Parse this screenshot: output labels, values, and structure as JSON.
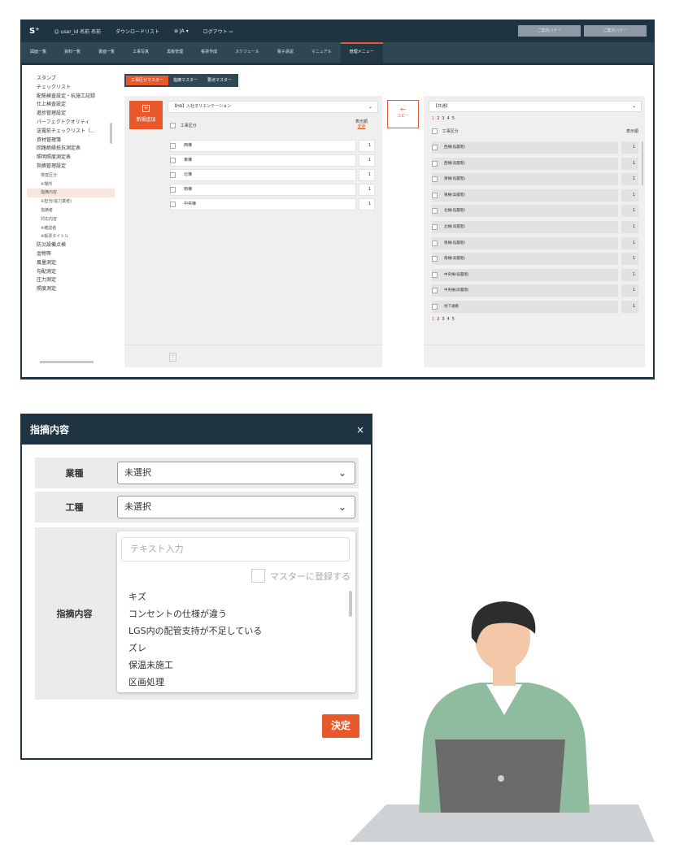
{
  "app": {
    "logo": "S⁺",
    "user": "user_id 名前 名前",
    "download": "ダウンロードリスト",
    "lang": "JA",
    "logout": "ログアウト",
    "btn_right_1": "ご案内バナー",
    "btn_right_2": "ご案内バナー"
  },
  "nav": [
    "図面一覧",
    "資料一覧",
    "書面一覧",
    "工事写真",
    "黒板管理",
    "帳票作成",
    "スケジュール",
    "電子承認",
    "マニュアル",
    "管理メニュー"
  ],
  "sidebar": [
    {
      "label": "スタンプ",
      "sub": false
    },
    {
      "label": "チェックリスト",
      "sub": false
    },
    {
      "label": "配筋検査設定・杭施工記録",
      "sub": false
    },
    {
      "label": "仕上検査設定",
      "sub": false
    },
    {
      "label": "進捗管理設定",
      "sub": false
    },
    {
      "label": "パーフェクトクオリティ",
      "sub": false
    },
    {
      "label": "送電前チェックリスト（…",
      "sub": false
    },
    {
      "label": "資材管理簿",
      "sub": false
    },
    {
      "label": "回路絶縁抵抗測定表",
      "sub": false
    },
    {
      "label": "照明照度測定表",
      "sub": false
    },
    {
      "label": "指摘管理設定",
      "sub": false
    },
    {
      "label": "検査区分",
      "sub": true
    },
    {
      "label": "※場所",
      "sub": true
    },
    {
      "label": "指摘内容",
      "sub": true,
      "selected": true
    },
    {
      "label": "※担当(協力業者)",
      "sub": true
    },
    {
      "label": "指摘者",
      "sub": true
    },
    {
      "label": "対応内容",
      "sub": true
    },
    {
      "label": "※確認者",
      "sub": true
    },
    {
      "label": "※帳票タイトル",
      "sub": true
    },
    {
      "label": "防災設備点検",
      "sub": false
    },
    {
      "label": "金物等",
      "sub": false
    },
    {
      "label": "風量測定",
      "sub": false
    },
    {
      "label": "勾配測定",
      "sub": false
    },
    {
      "label": "圧力測定",
      "sub": false
    },
    {
      "label": "照度測定",
      "sub": false
    }
  ],
  "tabs": [
    "工事区分マスター",
    "指摘マスター",
    "要点マスター"
  ],
  "left_panel": {
    "add_label": "新規追加",
    "select_value": "【HA】入社オリエンテーション",
    "col_name": "工事区分",
    "col_order": "表示順",
    "col_order_sub": "変更",
    "rows": [
      {
        "name": "西棟",
        "order": "1"
      },
      {
        "name": "東棟",
        "order": "1"
      },
      {
        "name": "北棟",
        "order": "1"
      },
      {
        "name": "南棟",
        "order": "1"
      },
      {
        "name": "中央棟",
        "order": "1"
      }
    ]
  },
  "copy_label": "コピー",
  "copy_arrow": "←",
  "right_panel": {
    "select_value": "【共通】",
    "pager_top": [
      "1",
      "2",
      "3",
      "4",
      "5"
    ],
    "col_name": "工事区分",
    "col_order": "表示順",
    "rows": [
      {
        "name": "西棟(低層階)",
        "order": "1"
      },
      {
        "name": "西棟(高層階)",
        "order": "1"
      },
      {
        "name": "東棟(低層階)",
        "order": "1"
      },
      {
        "name": "東棟(高層階)",
        "order": "1"
      },
      {
        "name": "北棟(低層階)",
        "order": "1"
      },
      {
        "name": "北棟(高層階)",
        "order": "1"
      },
      {
        "name": "南棟(低層階)",
        "order": "1"
      },
      {
        "name": "南棟(高層階)",
        "order": "1"
      },
      {
        "name": "中央棟(低層階)",
        "order": "1"
      },
      {
        "name": "中央棟(高層階)",
        "order": "1"
      },
      {
        "name": "地下通路",
        "order": "1"
      }
    ],
    "pager_bottom": [
      "1",
      "2",
      "3",
      "4",
      "5"
    ]
  },
  "modal": {
    "title": "指摘内容",
    "close": "×",
    "field1_label": "業種",
    "field1_value": "未選択",
    "field2_label": "工種",
    "field2_value": "未選択",
    "field3_label": "指摘内容",
    "text_placeholder": "テキスト入力",
    "register_label": "マスターに登録する",
    "options": [
      "キズ",
      "コンセントの仕様が違う",
      "LGS内の配管支持が不足している",
      "ズレ",
      "保温未施工",
      "区画処理"
    ],
    "submit": "決定"
  },
  "colors": {
    "accent": "#e8582b",
    "dark": "#1f3442",
    "nav": "#2f4654"
  }
}
